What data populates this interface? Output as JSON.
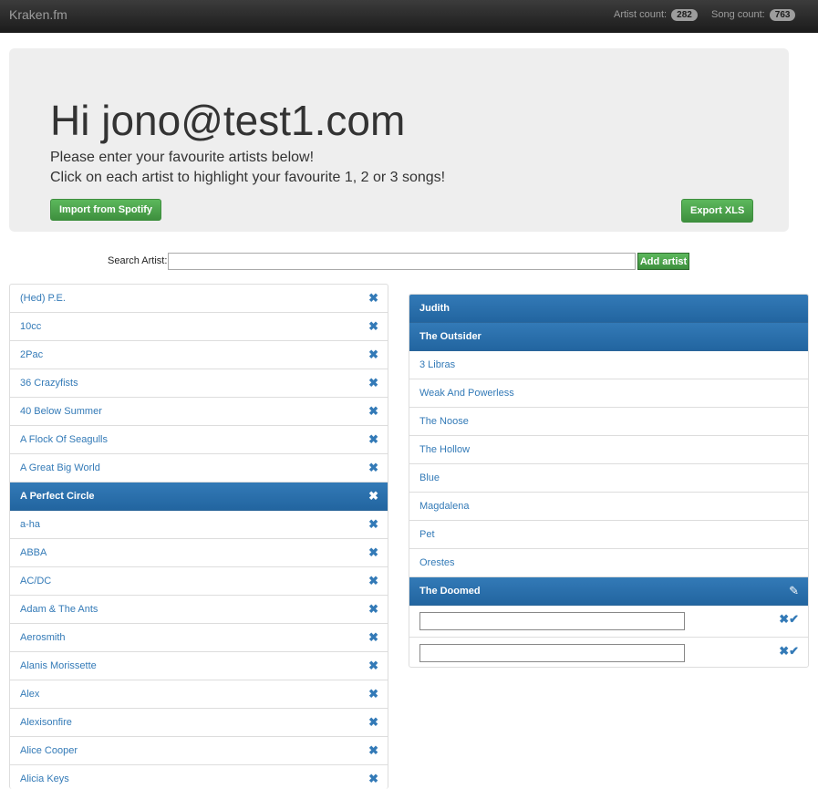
{
  "navbar": {
    "brand": "Kraken.fm",
    "artist_count_label": "Artist count:",
    "artist_count": "282",
    "song_count_label": "Song count:",
    "song_count": "763"
  },
  "hero": {
    "greeting": "Hi jono@test1.com",
    "line1": "Please enter your favourite artists below!",
    "line2": "Click on each artist to highlight your favourite 1, 2 or 3 songs!",
    "import_button": "Import from Spotify",
    "export_button": "Export XLS"
  },
  "search": {
    "label": "Search Artist:",
    "value": "",
    "add_button": "Add artist"
  },
  "artists": [
    {
      "name": "(Hed) P.E.",
      "active": false
    },
    {
      "name": "10cc",
      "active": false
    },
    {
      "name": "2Pac",
      "active": false
    },
    {
      "name": "36 Crazyfists",
      "active": false
    },
    {
      "name": "40 Below Summer",
      "active": false
    },
    {
      "name": "A Flock Of Seagulls",
      "active": false
    },
    {
      "name": "A Great Big World",
      "active": false
    },
    {
      "name": "A Perfect Circle",
      "active": true
    },
    {
      "name": "a-ha",
      "active": false
    },
    {
      "name": "ABBA",
      "active": false
    },
    {
      "name": "AC/DC",
      "active": false
    },
    {
      "name": "Adam & The Ants",
      "active": false
    },
    {
      "name": "Aerosmith",
      "active": false
    },
    {
      "name": "Alanis Morissette",
      "active": false
    },
    {
      "name": "Alex",
      "active": false
    },
    {
      "name": "Alexisonfire",
      "active": false
    },
    {
      "name": "Alice Cooper",
      "active": false
    },
    {
      "name": "Alicia Keys",
      "active": false
    }
  ],
  "songs": {
    "selected": [
      "Judith",
      "The Outsider"
    ],
    "list": [
      "3 Libras",
      "Weak And Powerless",
      "The Noose",
      "The Hollow",
      "Blue",
      "Magdalena",
      "Pet",
      "Orestes"
    ],
    "editing": "The Doomed",
    "new_song_fields": [
      "",
      ""
    ]
  },
  "icons": {
    "remove": "close-icon",
    "edit": "pencil-icon",
    "confirm": "check-icon"
  },
  "colors": {
    "navbar": "#222222",
    "hero_bg": "#eeeeee",
    "green_button": "#5cb85c",
    "active_blue": "#337ab7",
    "link_blue": "#337ab7"
  }
}
